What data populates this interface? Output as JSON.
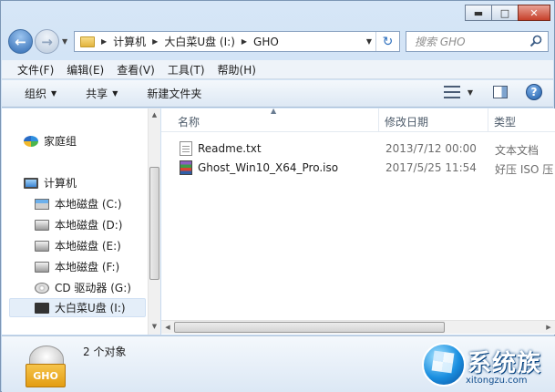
{
  "window": {
    "caption": {
      "minimize": "▬",
      "maximize": "□",
      "close": "✕"
    }
  },
  "nav": {
    "back": "←",
    "forward": "→",
    "dropdown": "▼"
  },
  "address": {
    "breadcrumbs": [
      "计算机",
      "大白菜U盘 (I:)",
      "GHO"
    ],
    "separator": "▶",
    "dropdown": "▼",
    "refresh": "↻"
  },
  "search": {
    "placeholder": "搜索 GHO"
  },
  "menu": {
    "items": [
      "文件(F)",
      "编辑(E)",
      "查看(V)",
      "工具(T)",
      "帮助(H)"
    ]
  },
  "toolbar": {
    "organize": "组织",
    "share": "共享",
    "new_folder": "新建文件夹",
    "arrow": "▼",
    "help": "?"
  },
  "sidebar": {
    "homegroup": "家庭组",
    "computer": "计算机",
    "drives": [
      "本地磁盘 (C:)",
      "本地磁盘 (D:)",
      "本地磁盘 (E:)",
      "本地磁盘 (F:)",
      "CD 驱动器 (G:)",
      "大白菜U盘 (I:)"
    ]
  },
  "columns": {
    "name": "名称",
    "modified": "修改日期",
    "type": "类型",
    "sort": "▲"
  },
  "files": [
    {
      "name": "Readme.txt",
      "date": "2013/7/12 00:00",
      "type": "文本文档",
      "icon": "text-file-icon"
    },
    {
      "name": "Ghost_Win10_X64_Pro.iso",
      "date": "2017/5/25 11:54",
      "type": "好压 ISO 压",
      "icon": "archive-file-icon"
    }
  ],
  "details": {
    "icon_label": "GHO",
    "count": "2 个对象"
  },
  "watermark": {
    "title": "系统族",
    "url": "xitongzu.com"
  },
  "scroll": {
    "up": "▲",
    "down": "▼",
    "left": "◀",
    "right": "▶"
  }
}
